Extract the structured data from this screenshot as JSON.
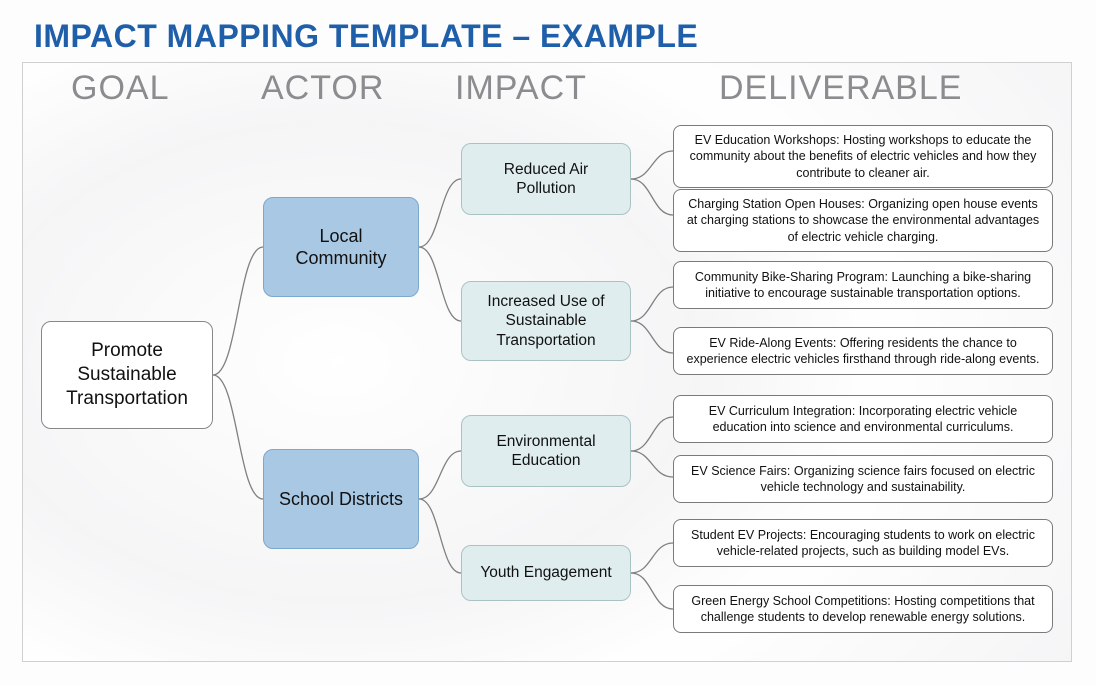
{
  "title": "IMPACT MAPPING TEMPLATE – EXAMPLE",
  "headers": {
    "goal": "GOAL",
    "actor": "ACTOR",
    "impact": "IMPACT",
    "deliverable": "DELIVERABLE"
  },
  "goal": "Promote Sustainable Transportation",
  "actors": [
    "Local Community",
    "School Districts"
  ],
  "impacts": [
    "Reduced Air Pollution",
    "Increased Use of Sustainable Transportation",
    "Environmental Education",
    "Youth Engagement"
  ],
  "deliverables": [
    "EV Education Workshops: Hosting workshops to educate the community about the benefits of electric vehicles and how they contribute to cleaner air.",
    "Charging Station Open Houses: Organizing open house events at charging stations to showcase the environmental advantages of electric vehicle charging.",
    "Community Bike-Sharing Program: Launching a bike-sharing initiative to encourage sustainable transportation options.",
    "EV Ride-Along Events: Offering residents the chance to experience electric vehicles firsthand through ride-along events.",
    "EV Curriculum Integration: Incorporating electric vehicle education into science and environmental curriculums.",
    "EV Science Fairs: Organizing science fairs focused on electric vehicle technology and sustainability.",
    "Student EV Projects: Encouraging students to work on electric vehicle-related projects, such as building model EVs.",
    "Green Energy School Competitions: Hosting competitions that challenge students to develop renewable energy solutions."
  ]
}
